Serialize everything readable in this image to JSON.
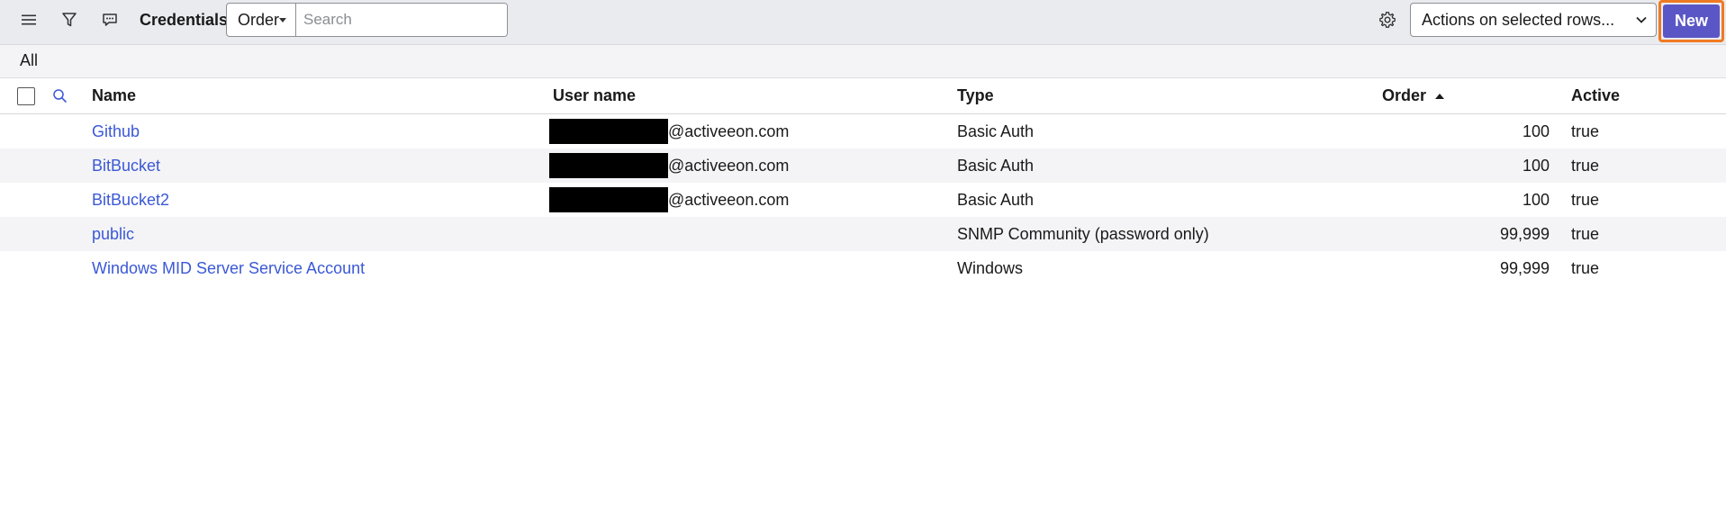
{
  "toolbar": {
    "title": "Credentials",
    "field_select": "Order",
    "search_placeholder": "Search",
    "actions_select": "Actions on selected rows...",
    "new_label": "New"
  },
  "breadcrumb": "All",
  "table": {
    "columns": {
      "name": "Name",
      "user_name": "User name",
      "type": "Type",
      "order": "Order",
      "active": "Active"
    },
    "rows": [
      {
        "name": "Github",
        "user_suffix": "@activeeon.com",
        "type": "Basic Auth",
        "order": "100",
        "active": "true"
      },
      {
        "name": "BitBucket",
        "user_suffix": "@activeeon.com",
        "type": "Basic Auth",
        "order": "100",
        "active": "true"
      },
      {
        "name": "BitBucket2",
        "user_suffix": "@activeeon.com",
        "type": "Basic Auth",
        "order": "100",
        "active": "true"
      },
      {
        "name": "public",
        "user_suffix": "",
        "type": "SNMP Community (password only)",
        "order": "99,999",
        "active": "true"
      },
      {
        "name": "Windows MID Server Service Account",
        "user_suffix": "",
        "type": "Windows",
        "order": "99,999",
        "active": "true"
      }
    ]
  },
  "icons": {
    "menu": "hamburger-menu-icon",
    "filter": "filter-icon",
    "conversation": "chat-icon",
    "settings": "gear-icon",
    "search": "search-icon"
  },
  "colors": {
    "link": "#3b58d6",
    "new_button": "#5b56c6",
    "highlight": "#f07a22"
  }
}
